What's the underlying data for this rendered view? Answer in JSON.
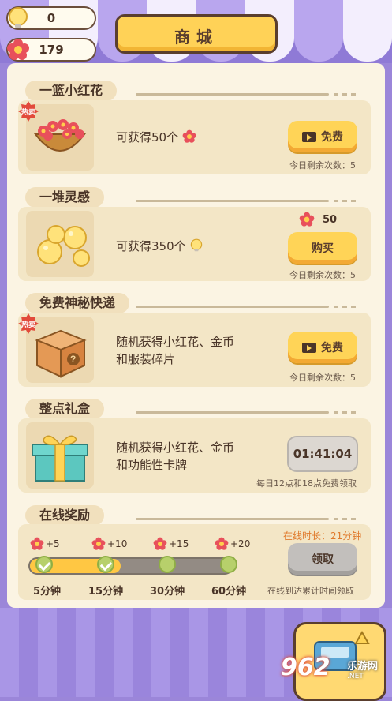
{
  "currency": {
    "bulbs": "0",
    "flowers": "179"
  },
  "title": "商城",
  "cards": [
    {
      "label": "一篮小红花",
      "hot": "热卖",
      "desc": "可获得50个",
      "button": "免费",
      "note": "今日剩余次数：5"
    },
    {
      "label": "一堆灵感",
      "price": "50",
      "desc": "可获得350个",
      "button": "购买",
      "note": "今日剩余次数：5"
    },
    {
      "label": "免费神秘快递",
      "hot": "热卖",
      "desc_line1": "随机获得小红花、金币",
      "desc_line2": "和服装碎片",
      "button": "免费",
      "note": "今日剩余次数：5"
    },
    {
      "label": "整点礼盒",
      "desc_line1": "随机获得小红花、金币",
      "desc_line2": "和功能性卡牌",
      "timer": "01:41:04",
      "note": "每日12点和18点免费领取"
    },
    {
      "label": "在线奖励",
      "online_time": "在线时长：21分钟",
      "button": "领取",
      "note": "在线到达累计时间领取",
      "rewards": [
        "+5",
        "+10",
        "+15",
        "+20"
      ],
      "times": [
        "5分钟",
        "15分钟",
        "30分钟",
        "60分钟"
      ],
      "progress": 0.45
    }
  ],
  "watermark": {
    "logo": "962",
    "cn": "乐游网",
    "url": ".NET"
  },
  "colors": {
    "accent": "#ffd457",
    "panel": "#fbf4e3",
    "card": "#f3e6c6",
    "awning": "#9b86d9"
  }
}
